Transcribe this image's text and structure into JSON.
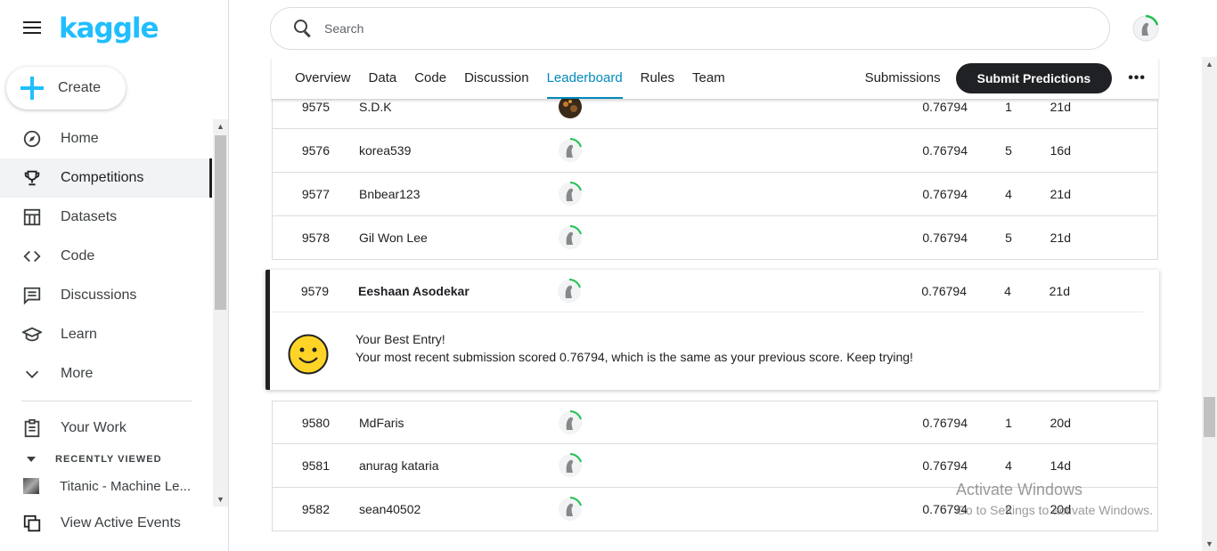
{
  "app": {
    "logo_text": "kaggle",
    "brand_color": "#20beff",
    "accent_color": "#008abc"
  },
  "sidebar": {
    "create_label": "Create",
    "items": [
      {
        "label": "Home",
        "icon": "compass-icon"
      },
      {
        "label": "Competitions",
        "icon": "trophy-icon",
        "active": true
      },
      {
        "label": "Datasets",
        "icon": "table-icon"
      },
      {
        "label": "Code",
        "icon": "code-icon"
      },
      {
        "label": "Discussions",
        "icon": "comment-icon"
      },
      {
        "label": "Learn",
        "icon": "school-icon"
      },
      {
        "label": "More",
        "icon": "chevron-down-icon"
      }
    ],
    "your_work_label": "Your Work",
    "recently_viewed_label": "RECENTLY VIEWED",
    "recent_items": [
      {
        "label": "Titanic - Machine Le..."
      }
    ],
    "view_events_label": "View Active Events"
  },
  "search": {
    "placeholder": "Search"
  },
  "tabs": {
    "items": [
      "Overview",
      "Data",
      "Code",
      "Discussion",
      "Leaderboard",
      "Rules",
      "Team"
    ],
    "active": "Leaderboard",
    "submissions_label": "Submissions",
    "submit_label": "Submit Predictions",
    "more_label": "•••"
  },
  "leaderboard_top": [
    {
      "rank": "9575",
      "name": "S.D.K",
      "score": "0.76794",
      "entries": "1",
      "last": "21d",
      "avatar": "photo"
    },
    {
      "rank": "9576",
      "name": "korea539",
      "score": "0.76794",
      "entries": "5",
      "last": "16d"
    },
    {
      "rank": "9577",
      "name": "Bnbear123",
      "score": "0.76794",
      "entries": "4",
      "last": "21d"
    },
    {
      "rank": "9578",
      "name": "Gil Won Lee",
      "score": "0.76794",
      "entries": "5",
      "last": "21d"
    }
  ],
  "best_entry": {
    "rank": "9579",
    "name": "Eeshaan Asodekar",
    "score": "0.76794",
    "entries": "4",
    "last": "21d",
    "title": "Your Best Entry!",
    "message": "Your most recent submission scored 0.76794, which is the same as your previous score. Keep trying!"
  },
  "leaderboard_bottom": [
    {
      "rank": "9580",
      "name": "MdFaris",
      "score": "0.76794",
      "entries": "1",
      "last": "20d"
    },
    {
      "rank": "9581",
      "name": "anurag kataria",
      "score": "0.76794",
      "entries": "4",
      "last": "14d"
    },
    {
      "rank": "9582",
      "name": "sean40502",
      "score": "0.76794",
      "entries": "2",
      "last": "20d"
    }
  ],
  "watermark": {
    "line1": "Activate Windows",
    "line2": "Go to Settings to activate Windows."
  }
}
